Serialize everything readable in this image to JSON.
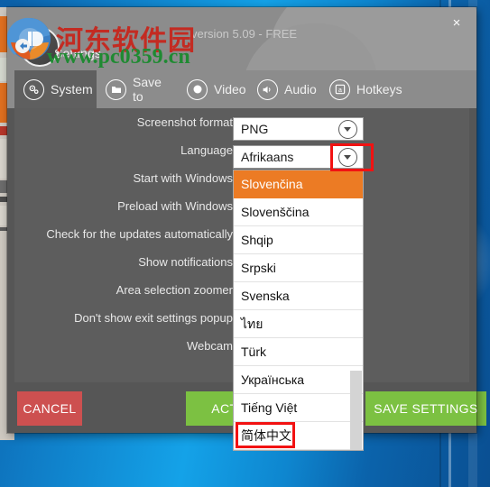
{
  "window": {
    "title": "Settings",
    "version": "version 5.09 - FREE",
    "close_label": "×"
  },
  "watermark": {
    "site_name": "河东软件园",
    "site_url": "www.pc0359.cn"
  },
  "tabs": [
    {
      "label": "System",
      "icon": "gears-icon",
      "active": true
    },
    {
      "label": "Save to",
      "icon": "folder-icon",
      "active": false
    },
    {
      "label": "Video",
      "icon": "record-icon",
      "active": false
    },
    {
      "label": "Audio",
      "icon": "speaker-icon",
      "active": false
    },
    {
      "label": "Hotkeys",
      "icon": "keycap-a-icon",
      "active": false
    }
  ],
  "settings": {
    "rows": [
      "Screenshot format",
      "Language",
      "Start with Windows",
      "Preload with Windows",
      "Check for the updates automatically",
      "Show notifications",
      "Area selection zoomer",
      "Don't show exit settings popup",
      "Webcam"
    ],
    "screenshot_format": {
      "value": "PNG"
    },
    "language": {
      "value": "Afrikaans"
    }
  },
  "language_dropdown": {
    "selected": "Slovenčina",
    "options": [
      "Slovenčina",
      "Slovenščina",
      "Shqip",
      "Srpski",
      "Svenska",
      "ไทย",
      "Türk",
      "Українська",
      "Tiếng Việt",
      "简体中文"
    ]
  },
  "footer": {
    "cancel": "CANCEL",
    "activate": "ACTIVATE",
    "save": "SAVE SETTINGS"
  },
  "colors": {
    "accent_orange": "#ec7b24",
    "green_button": "#7cc142",
    "red_button": "#cd5050",
    "highlight_red": "#f21212",
    "panel_gray": "#5d5d5d",
    "header_gray": "#8c8c8c"
  }
}
